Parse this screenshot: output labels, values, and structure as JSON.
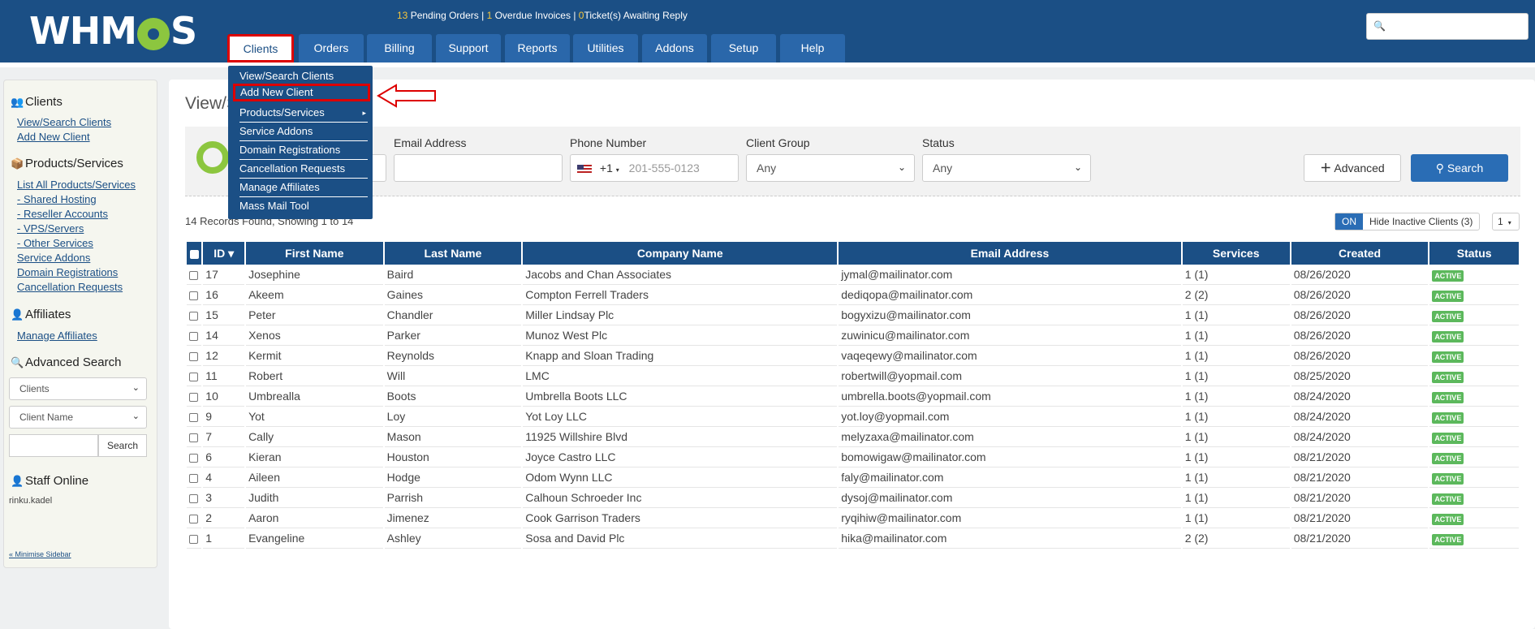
{
  "header": {
    "logo": "WHMCS",
    "alerts": {
      "pending_count": "13",
      "pending_label": "Pending Orders",
      "overdue_count": "1",
      "overdue_label": "Overdue Invoices",
      "tickets_count": "0",
      "tickets_label": "Ticket(s) Awaiting Reply",
      "separator": "|"
    },
    "search_icon": "search-icon"
  },
  "nav": {
    "tabs": [
      "Clients",
      "Orders",
      "Billing",
      "Support",
      "Reports",
      "Utilities",
      "Addons",
      "Setup",
      "Help"
    ],
    "active": "Clients"
  },
  "dropdown": {
    "items": [
      "View/Search Clients",
      "Add New Client",
      "Products/Services",
      "Service Addons",
      "Domain Registrations",
      "Cancellation Requests",
      "Manage Affiliates",
      "Mass Mail Tool"
    ],
    "highlighted": "Add New Client",
    "submenu_indicator": "▸"
  },
  "sidebar": {
    "clients_heading": "Clients",
    "clients_links": [
      "View/Search Clients",
      "Add New Client"
    ],
    "products_heading": "Products/Services",
    "products_links": [
      "List All Products/Services",
      "- Shared Hosting",
      "- Reseller Accounts",
      "- VPS/Servers",
      "- Other Services",
      "Service Addons",
      "Domain Registrations",
      "Cancellation Requests"
    ],
    "affiliates_heading": "Affiliates",
    "affiliates_links": [
      "Manage Affiliates"
    ],
    "advanced_heading": "Advanced Search",
    "adv_select1": "Clients",
    "adv_select2": "Client Name",
    "adv_search_button": "Search",
    "staff_heading": "Staff Online",
    "staff_user": "rinku.kadel",
    "minimise": "« Minimise Sidebar"
  },
  "main": {
    "page_title": "View/S",
    "filters": {
      "email_label": "Email Address",
      "phone_label": "Phone Number",
      "phone_code": "+1",
      "phone_placeholder": "201-555-0123",
      "group_label": "Client Group",
      "group_value": "Any",
      "status_label": "Status",
      "status_value": "Any",
      "advanced_button": "Advanced",
      "search_button": "Search"
    },
    "records_text": "14 Records Found, Showing 1 to 14",
    "toggle_on": "ON",
    "toggle_label": "Hide Inactive Clients (3)",
    "page_select": "1",
    "columns": [
      "ID ▾",
      "First Name",
      "Last Name",
      "Company Name",
      "Email Address",
      "Services",
      "Created",
      "Status"
    ],
    "rows": [
      [
        "17",
        "Josephine",
        "Baird",
        "Jacobs and Chan Associates",
        "jymal@mailinator.com",
        "1 (1)",
        "08/26/2020",
        "ACTIVE"
      ],
      [
        "16",
        "Akeem",
        "Gaines",
        "Compton Ferrell Traders",
        "dediqopa@mailinator.com",
        "2 (2)",
        "08/26/2020",
        "ACTIVE"
      ],
      [
        "15",
        "Peter",
        "Chandler",
        "Miller Lindsay Plc",
        "bogyxizu@mailinator.com",
        "1 (1)",
        "08/26/2020",
        "ACTIVE"
      ],
      [
        "14",
        "Xenos",
        "Parker",
        "Munoz West Plc",
        "zuwinicu@mailinator.com",
        "1 (1)",
        "08/26/2020",
        "ACTIVE"
      ],
      [
        "12",
        "Kermit",
        "Reynolds",
        "Knapp and Sloan Trading",
        "vaqeqewy@mailinator.com",
        "1 (1)",
        "08/26/2020",
        "ACTIVE"
      ],
      [
        "11",
        "Robert",
        "Will",
        "LMC",
        "robertwill@yopmail.com",
        "1 (1)",
        "08/25/2020",
        "ACTIVE"
      ],
      [
        "10",
        "Umbrealla",
        "Boots",
        "Umbrella Boots LLC",
        "umbrella.boots@yopmail.com",
        "1 (1)",
        "08/24/2020",
        "ACTIVE"
      ],
      [
        "9",
        "Yot",
        "Loy",
        "Yot Loy LLC",
        "yot.loy@yopmail.com",
        "1 (1)",
        "08/24/2020",
        "ACTIVE"
      ],
      [
        "7",
        "Cally",
        "Mason",
        "11925 Willshire Blvd",
        "melyzaxa@mailinator.com",
        "1 (1)",
        "08/24/2020",
        "ACTIVE"
      ],
      [
        "6",
        "Kieran",
        "Houston",
        "Joyce Castro LLC",
        "bomowigaw@mailinator.com",
        "1 (1)",
        "08/21/2020",
        "ACTIVE"
      ],
      [
        "4",
        "Aileen",
        "Hodge",
        "Odom Wynn LLC",
        "faly@mailinator.com",
        "1 (1)",
        "08/21/2020",
        "ACTIVE"
      ],
      [
        "3",
        "Judith",
        "Parrish",
        "Calhoun Schroeder Inc",
        "dysoj@mailinator.com",
        "1 (1)",
        "08/21/2020",
        "ACTIVE"
      ],
      [
        "2",
        "Aaron",
        "Jimenez",
        "Cook Garrison Traders",
        "ryqihiw@mailinator.com",
        "1 (1)",
        "08/21/2020",
        "ACTIVE"
      ],
      [
        "1",
        "Evangeline",
        "Ashley",
        "Sosa and David Plc",
        "hika@mailinator.com",
        "2 (2)",
        "08/21/2020",
        "ACTIVE"
      ]
    ]
  },
  "colors": {
    "header_blue": "#1b4f85",
    "tab_blue": "#2a67aa",
    "active_green": "#5cb85c",
    "highlight_red": "#dd0000",
    "logo_green": "#8cc63f"
  }
}
